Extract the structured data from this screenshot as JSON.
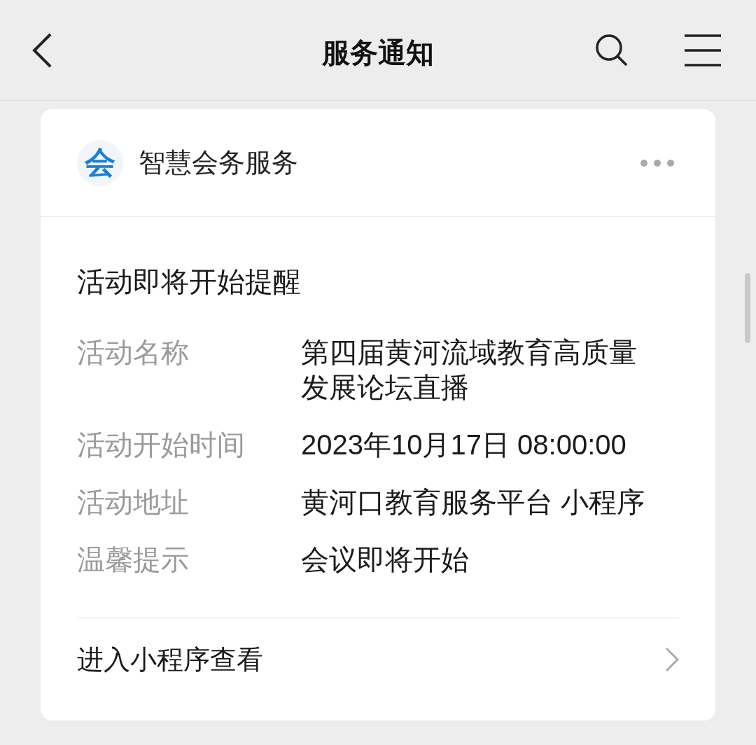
{
  "nav": {
    "title": "服务通知"
  },
  "card": {
    "logo_text": "会",
    "service_name": "智慧会务服务",
    "title": "活动即将开始提醒",
    "fields": [
      {
        "label": "活动名称",
        "value": "第四届黄河流域教育高质量发展论坛直播"
      },
      {
        "label": "活动开始时间",
        "value": "2023年10月17日 08:00:00"
      },
      {
        "label": "活动地址",
        "value": "黄河口教育服务平台 小程序"
      },
      {
        "label": "温馨提示",
        "value": "会议即将开始"
      }
    ],
    "link": "进入小程序查看"
  }
}
